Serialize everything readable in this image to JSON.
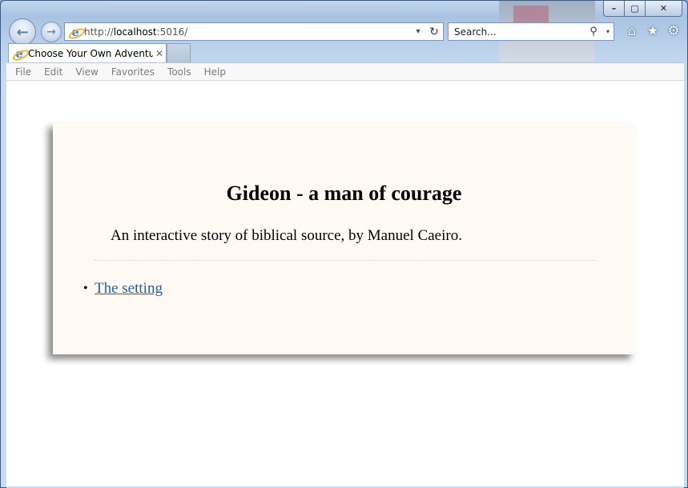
{
  "window": {
    "caption_minimize": "–",
    "caption_maximize": "▢",
    "caption_close": "✕"
  },
  "toolbar": {
    "back_icon": "←",
    "forward_icon": "→",
    "address_prefix": "http://",
    "address_host": "localhost",
    "address_suffix": ":5016/",
    "address_dropdown": "▾",
    "refresh_icon": "↻",
    "search_placeholder": "Search...",
    "search_icon": "⚲",
    "search_dropdown": "▾",
    "home_icon": "⌂",
    "favorites_icon": "★",
    "settings_icon": "⚙"
  },
  "tabs": [
    {
      "label": "Choose Your Own Adventure",
      "close": "✕"
    }
  ],
  "menu": [
    "File",
    "Edit",
    "View",
    "Favorites",
    "Tools",
    "Help"
  ],
  "page": {
    "title": "Gideon - a man of courage",
    "subtitle": "An interactive story of biblical source, by Manuel Caeiro.",
    "links": [
      {
        "bullet": "•",
        "label": "The setting"
      }
    ]
  },
  "colors": {
    "card_background": "#fffbf4",
    "link": "#1a5fb4"
  }
}
